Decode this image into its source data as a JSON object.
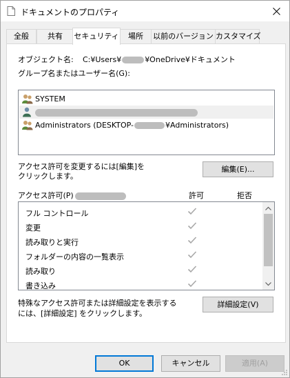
{
  "window": {
    "title": "ドキュメントのプロパティ"
  },
  "tabs": [
    {
      "label": "全般"
    },
    {
      "label": "共有"
    },
    {
      "label": "セキュリティ"
    },
    {
      "label": "場所"
    },
    {
      "label": "以前のバージョン"
    },
    {
      "label": "カスタマイズ"
    }
  ],
  "security": {
    "object_name_label": "オブジェクト名:",
    "object_path_prefix": "C:¥Users¥",
    "object_path_suffix": "¥OneDrive¥ドキュメント",
    "group_label": "グループ名またはユーザー名(G):",
    "users": [
      {
        "name": "SYSTEM",
        "icon": "users-group-icon"
      },
      {
        "name": "",
        "icon": "user-icon",
        "redacted": true
      },
      {
        "name_prefix": "Administrators (DESKTOP-",
        "name_suffix": "¥Administrators)",
        "icon": "users-group-icon"
      }
    ],
    "edit_hint_line1": "アクセス許可を変更するには[編集]を",
    "edit_hint_line2": "クリックします。",
    "edit_button": "編集(E)...",
    "perm_label": "アクセス許可(P)",
    "allow_header": "許可",
    "deny_header": "拒否",
    "permissions": [
      {
        "name": "フル コントロール",
        "allow": true,
        "deny": false
      },
      {
        "name": "変更",
        "allow": true,
        "deny": false
      },
      {
        "name": "読み取りと実行",
        "allow": true,
        "deny": false
      },
      {
        "name": "フォルダーの内容の一覧表示",
        "allow": true,
        "deny": false
      },
      {
        "name": "読み取り",
        "allow": true,
        "deny": false
      },
      {
        "name": "書き込み",
        "allow": true,
        "deny": false
      }
    ],
    "advanced_hint_line1": "特殊なアクセス許可または詳細設定を表示する",
    "advanced_hint_line2": "には、[詳細設定] をクリックします。",
    "advanced_button": "詳細設定(V)"
  },
  "footer": {
    "ok": "OK",
    "cancel": "キャンセル",
    "apply": "適用(A)"
  },
  "colors": {
    "check": "#a8a8a8",
    "accent": "#0078d7"
  }
}
